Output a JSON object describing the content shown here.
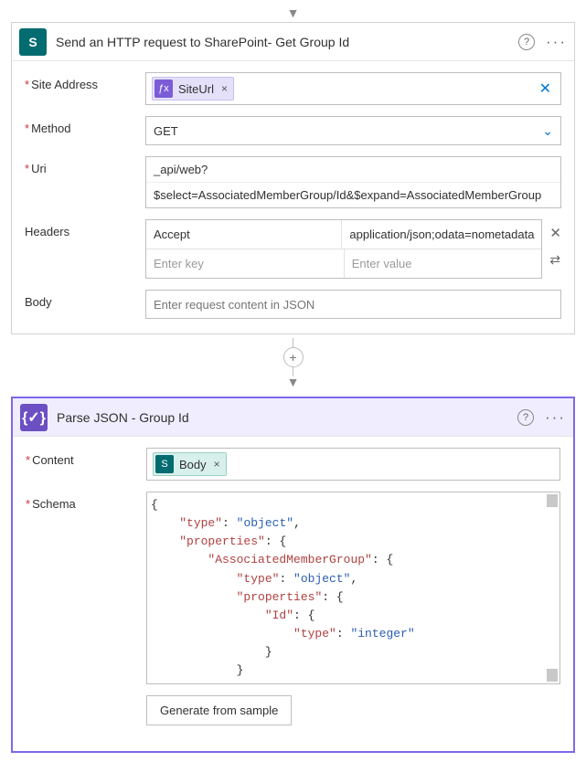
{
  "sp_action": {
    "title": "Send an HTTP request to SharePoint- Get Group Id",
    "fields": {
      "site_address_label": "Site Address",
      "site_address_token": "SiteUrl",
      "method_label": "Method",
      "method_value": "GET",
      "uri_label": "Uri",
      "uri_line1": "_api/web?",
      "uri_line2": "$select=AssociatedMemberGroup/Id&$expand=AssociatedMemberGroup",
      "headers_label": "Headers",
      "headers_rows": [
        {
          "key": "Accept",
          "value": "application/json;odata=nometadata"
        }
      ],
      "headers_key_placeholder": "Enter key",
      "headers_value_placeholder": "Enter value",
      "body_label": "Body",
      "body_placeholder": "Enter request content in JSON"
    }
  },
  "parse_action": {
    "title": "Parse JSON - Group Id",
    "fields": {
      "content_label": "Content",
      "content_token": "Body",
      "schema_label": "Schema"
    },
    "button": "Generate from sample"
  }
}
